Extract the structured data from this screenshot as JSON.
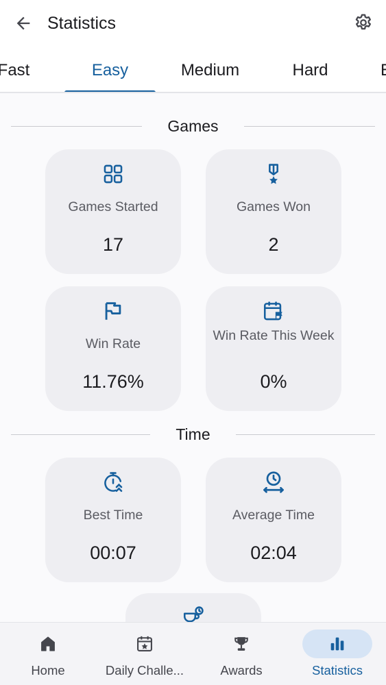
{
  "header": {
    "title": "Statistics"
  },
  "tabs": [
    {
      "label": "Fast"
    },
    {
      "label": "Easy",
      "active": true
    },
    {
      "label": "Medium"
    },
    {
      "label": "Hard"
    },
    {
      "label": "E"
    }
  ],
  "sections": {
    "games": {
      "title": "Games",
      "cards": [
        {
          "label": "Games Started",
          "value": "17"
        },
        {
          "label": "Games Won",
          "value": "2"
        },
        {
          "label": "Win Rate",
          "value": "11.76%"
        },
        {
          "label": "Win Rate This Week",
          "value": "0%"
        }
      ]
    },
    "time": {
      "title": "Time",
      "cards": [
        {
          "label": "Best Time",
          "value": "00:07"
        },
        {
          "label": "Average Time",
          "value": "02:04"
        }
      ]
    }
  },
  "nav": [
    {
      "label": "Home"
    },
    {
      "label": "Daily Challe..."
    },
    {
      "label": "Awards"
    },
    {
      "label": "Statistics",
      "active": true
    }
  ],
  "colors": {
    "accent": "#17609e",
    "card": "#eeeef2",
    "active_pill": "#d6e4f5"
  }
}
